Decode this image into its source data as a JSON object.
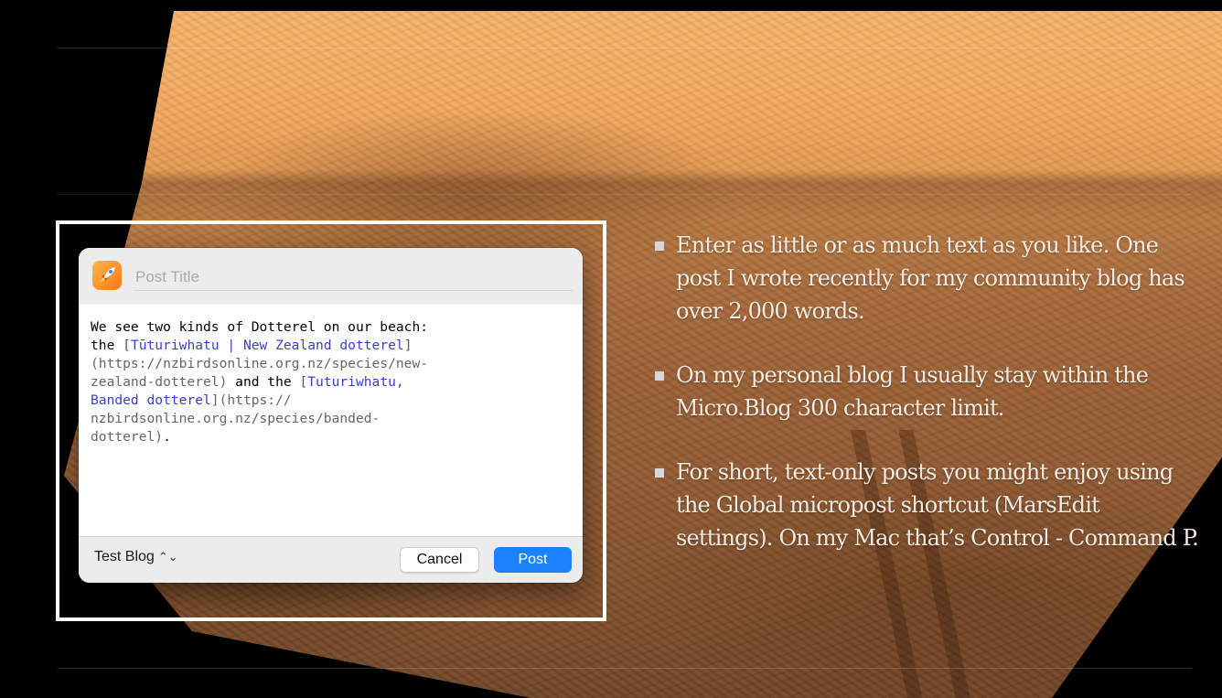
{
  "dialog": {
    "title_placeholder": "Post Title",
    "icon": "rocket-icon",
    "body": [
      {
        "text": "We see two kinds of Dotterel on our beach:",
        "kind": "plain"
      },
      {
        "text": "the ",
        "kind": "plain"
      },
      {
        "text": "[",
        "kind": "bracket"
      },
      {
        "text": "Tūturiwhatu | New Zealand dotterel",
        "kind": "link"
      },
      {
        "text": "]",
        "kind": "bracket"
      },
      {
        "text": "(https://nzbirdsonline.org.nz/species/new-",
        "kind": "url"
      },
      {
        "text": "zealand-dotterel)",
        "kind": "url"
      },
      {
        "text": " and the ",
        "kind": "plain"
      },
      {
        "text": "[",
        "kind": "bracket"
      },
      {
        "text": "Tuturiwhatu,",
        "kind": "link"
      },
      {
        "text": "Banded dotterel",
        "kind": "link"
      },
      {
        "text": "](https://",
        "kind": "url"
      },
      {
        "text": "nzbirdsonline.org.nz/species/banded-",
        "kind": "url"
      },
      {
        "text": "dotterel)",
        "kind": "url"
      },
      {
        "text": ".",
        "kind": "plain"
      }
    ],
    "blog_name": "Test Blog",
    "blog_chevron": "⌃⌄",
    "cancel_label": "Cancel",
    "post_label": "Post"
  },
  "bullets": [
    "Enter as little or as much  text as you like. One post I wrote recently for my community blog has over 2,000 words.",
    "On my personal blog I usually stay within the Micro.Blog 300 character limit.",
    "For short, text-only posts you might enjoy using the Global micropost shortcut (MarsEdit settings). On my Mac that’s Control - Command P."
  ],
  "colors": {
    "accent": "#1a82ff",
    "link": "#3a3ed0",
    "frame": "#ffffff"
  }
}
